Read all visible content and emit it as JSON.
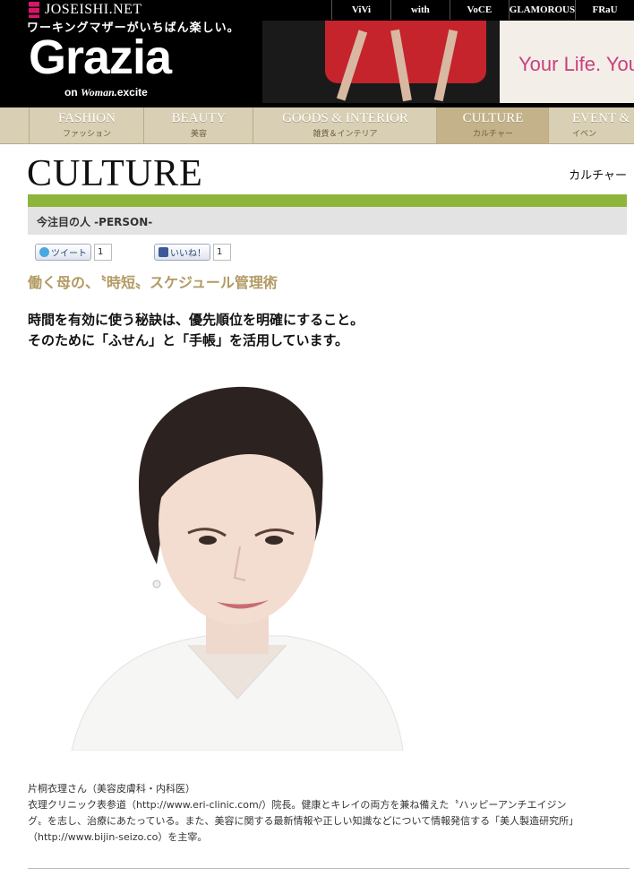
{
  "header": {
    "site_name": "JOSEISHI.NET",
    "tagline": "ワーキングマザーがいちばん楽しい。",
    "brand": "Grazia",
    "brand_sub_on": "on",
    "brand_sub_woman": "Woman.",
    "brand_sub_excite": "excite",
    "magazines": [
      "ViVi",
      "with",
      "VoCE",
      "GLAMOROUS",
      "FRaU"
    ],
    "banner_slogan": "Your Life. You"
  },
  "nav": [
    {
      "en": "FASHION",
      "jp": "ファッション"
    },
    {
      "en": "BEAUTY",
      "jp": "美容"
    },
    {
      "en": "GOODS & INTERIOR",
      "jp": "雑貨＆インテリア"
    },
    {
      "en": "CULTURE",
      "jp": "カルチャー"
    },
    {
      "en": "EVENT &",
      "jp": "イベン"
    }
  ],
  "category": {
    "title": "CULTURE",
    "jp": "カルチャー"
  },
  "section_title": "今注目の人 -PERSON-",
  "share": {
    "tweet_label": "ツイート",
    "tweet_count": "1",
    "like_label": "いいね！",
    "like_count": "1"
  },
  "article": {
    "headline": "働く母の、〝時短〟スケジュール管理術",
    "lead_1": "時間を有効に使う秘訣は、優先順位を明確にすること。",
    "lead_2": "そのために「ふせん」と「手帳」を活用しています。",
    "caption_1": "片桐衣理さん（美容皮膚科・内科医）",
    "caption_2": "衣理クリニック表参道（http://www.eri-clinic.com/）院長。健康とキレイの両方を兼ね備えた〝ハッピーアンチエイジン",
    "caption_3": "グ〟を志し、治療にあたっている。また、美容に関する最新情報や正しい知識などについて情報発信する「美人製造研究所」",
    "caption_4": "（http://www.bijin-seizo.co）を主宰。"
  },
  "colors": {
    "accent_green": "#8db53c",
    "nav_bg": "#d9cfb4",
    "headline_gold": "#b29a63",
    "brand_pink": "#d9146b"
  }
}
